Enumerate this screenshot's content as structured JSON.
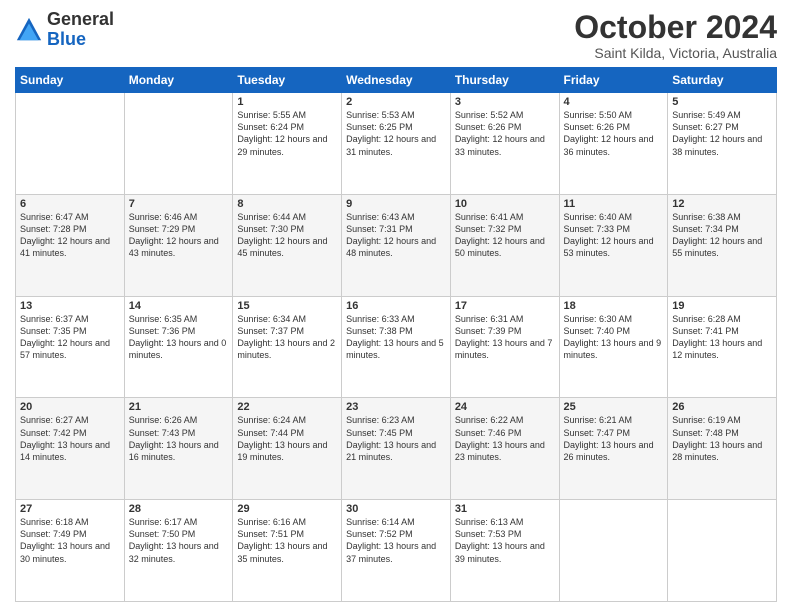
{
  "header": {
    "logo_general": "General",
    "logo_blue": "Blue",
    "month_title": "October 2024",
    "location": "Saint Kilda, Victoria, Australia"
  },
  "days_of_week": [
    "Sunday",
    "Monday",
    "Tuesday",
    "Wednesday",
    "Thursday",
    "Friday",
    "Saturday"
  ],
  "weeks": [
    [
      {
        "day": "",
        "info": ""
      },
      {
        "day": "",
        "info": ""
      },
      {
        "day": "1",
        "info": "Sunrise: 5:55 AM\nSunset: 6:24 PM\nDaylight: 12 hours and 29 minutes."
      },
      {
        "day": "2",
        "info": "Sunrise: 5:53 AM\nSunset: 6:25 PM\nDaylight: 12 hours and 31 minutes."
      },
      {
        "day": "3",
        "info": "Sunrise: 5:52 AM\nSunset: 6:26 PM\nDaylight: 12 hours and 33 minutes."
      },
      {
        "day": "4",
        "info": "Sunrise: 5:50 AM\nSunset: 6:26 PM\nDaylight: 12 hours and 36 minutes."
      },
      {
        "day": "5",
        "info": "Sunrise: 5:49 AM\nSunset: 6:27 PM\nDaylight: 12 hours and 38 minutes."
      }
    ],
    [
      {
        "day": "6",
        "info": "Sunrise: 6:47 AM\nSunset: 7:28 PM\nDaylight: 12 hours and 41 minutes."
      },
      {
        "day": "7",
        "info": "Sunrise: 6:46 AM\nSunset: 7:29 PM\nDaylight: 12 hours and 43 minutes."
      },
      {
        "day": "8",
        "info": "Sunrise: 6:44 AM\nSunset: 7:30 PM\nDaylight: 12 hours and 45 minutes."
      },
      {
        "day": "9",
        "info": "Sunrise: 6:43 AM\nSunset: 7:31 PM\nDaylight: 12 hours and 48 minutes."
      },
      {
        "day": "10",
        "info": "Sunrise: 6:41 AM\nSunset: 7:32 PM\nDaylight: 12 hours and 50 minutes."
      },
      {
        "day": "11",
        "info": "Sunrise: 6:40 AM\nSunset: 7:33 PM\nDaylight: 12 hours and 53 minutes."
      },
      {
        "day": "12",
        "info": "Sunrise: 6:38 AM\nSunset: 7:34 PM\nDaylight: 12 hours and 55 minutes."
      }
    ],
    [
      {
        "day": "13",
        "info": "Sunrise: 6:37 AM\nSunset: 7:35 PM\nDaylight: 12 hours and 57 minutes."
      },
      {
        "day": "14",
        "info": "Sunrise: 6:35 AM\nSunset: 7:36 PM\nDaylight: 13 hours and 0 minutes."
      },
      {
        "day": "15",
        "info": "Sunrise: 6:34 AM\nSunset: 7:37 PM\nDaylight: 13 hours and 2 minutes."
      },
      {
        "day": "16",
        "info": "Sunrise: 6:33 AM\nSunset: 7:38 PM\nDaylight: 13 hours and 5 minutes."
      },
      {
        "day": "17",
        "info": "Sunrise: 6:31 AM\nSunset: 7:39 PM\nDaylight: 13 hours and 7 minutes."
      },
      {
        "day": "18",
        "info": "Sunrise: 6:30 AM\nSunset: 7:40 PM\nDaylight: 13 hours and 9 minutes."
      },
      {
        "day": "19",
        "info": "Sunrise: 6:28 AM\nSunset: 7:41 PM\nDaylight: 13 hours and 12 minutes."
      }
    ],
    [
      {
        "day": "20",
        "info": "Sunrise: 6:27 AM\nSunset: 7:42 PM\nDaylight: 13 hours and 14 minutes."
      },
      {
        "day": "21",
        "info": "Sunrise: 6:26 AM\nSunset: 7:43 PM\nDaylight: 13 hours and 16 minutes."
      },
      {
        "day": "22",
        "info": "Sunrise: 6:24 AM\nSunset: 7:44 PM\nDaylight: 13 hours and 19 minutes."
      },
      {
        "day": "23",
        "info": "Sunrise: 6:23 AM\nSunset: 7:45 PM\nDaylight: 13 hours and 21 minutes."
      },
      {
        "day": "24",
        "info": "Sunrise: 6:22 AM\nSunset: 7:46 PM\nDaylight: 13 hours and 23 minutes."
      },
      {
        "day": "25",
        "info": "Sunrise: 6:21 AM\nSunset: 7:47 PM\nDaylight: 13 hours and 26 minutes."
      },
      {
        "day": "26",
        "info": "Sunrise: 6:19 AM\nSunset: 7:48 PM\nDaylight: 13 hours and 28 minutes."
      }
    ],
    [
      {
        "day": "27",
        "info": "Sunrise: 6:18 AM\nSunset: 7:49 PM\nDaylight: 13 hours and 30 minutes."
      },
      {
        "day": "28",
        "info": "Sunrise: 6:17 AM\nSunset: 7:50 PM\nDaylight: 13 hours and 32 minutes."
      },
      {
        "day": "29",
        "info": "Sunrise: 6:16 AM\nSunset: 7:51 PM\nDaylight: 13 hours and 35 minutes."
      },
      {
        "day": "30",
        "info": "Sunrise: 6:14 AM\nSunset: 7:52 PM\nDaylight: 13 hours and 37 minutes."
      },
      {
        "day": "31",
        "info": "Sunrise: 6:13 AM\nSunset: 7:53 PM\nDaylight: 13 hours and 39 minutes."
      },
      {
        "day": "",
        "info": ""
      },
      {
        "day": "",
        "info": ""
      }
    ]
  ]
}
